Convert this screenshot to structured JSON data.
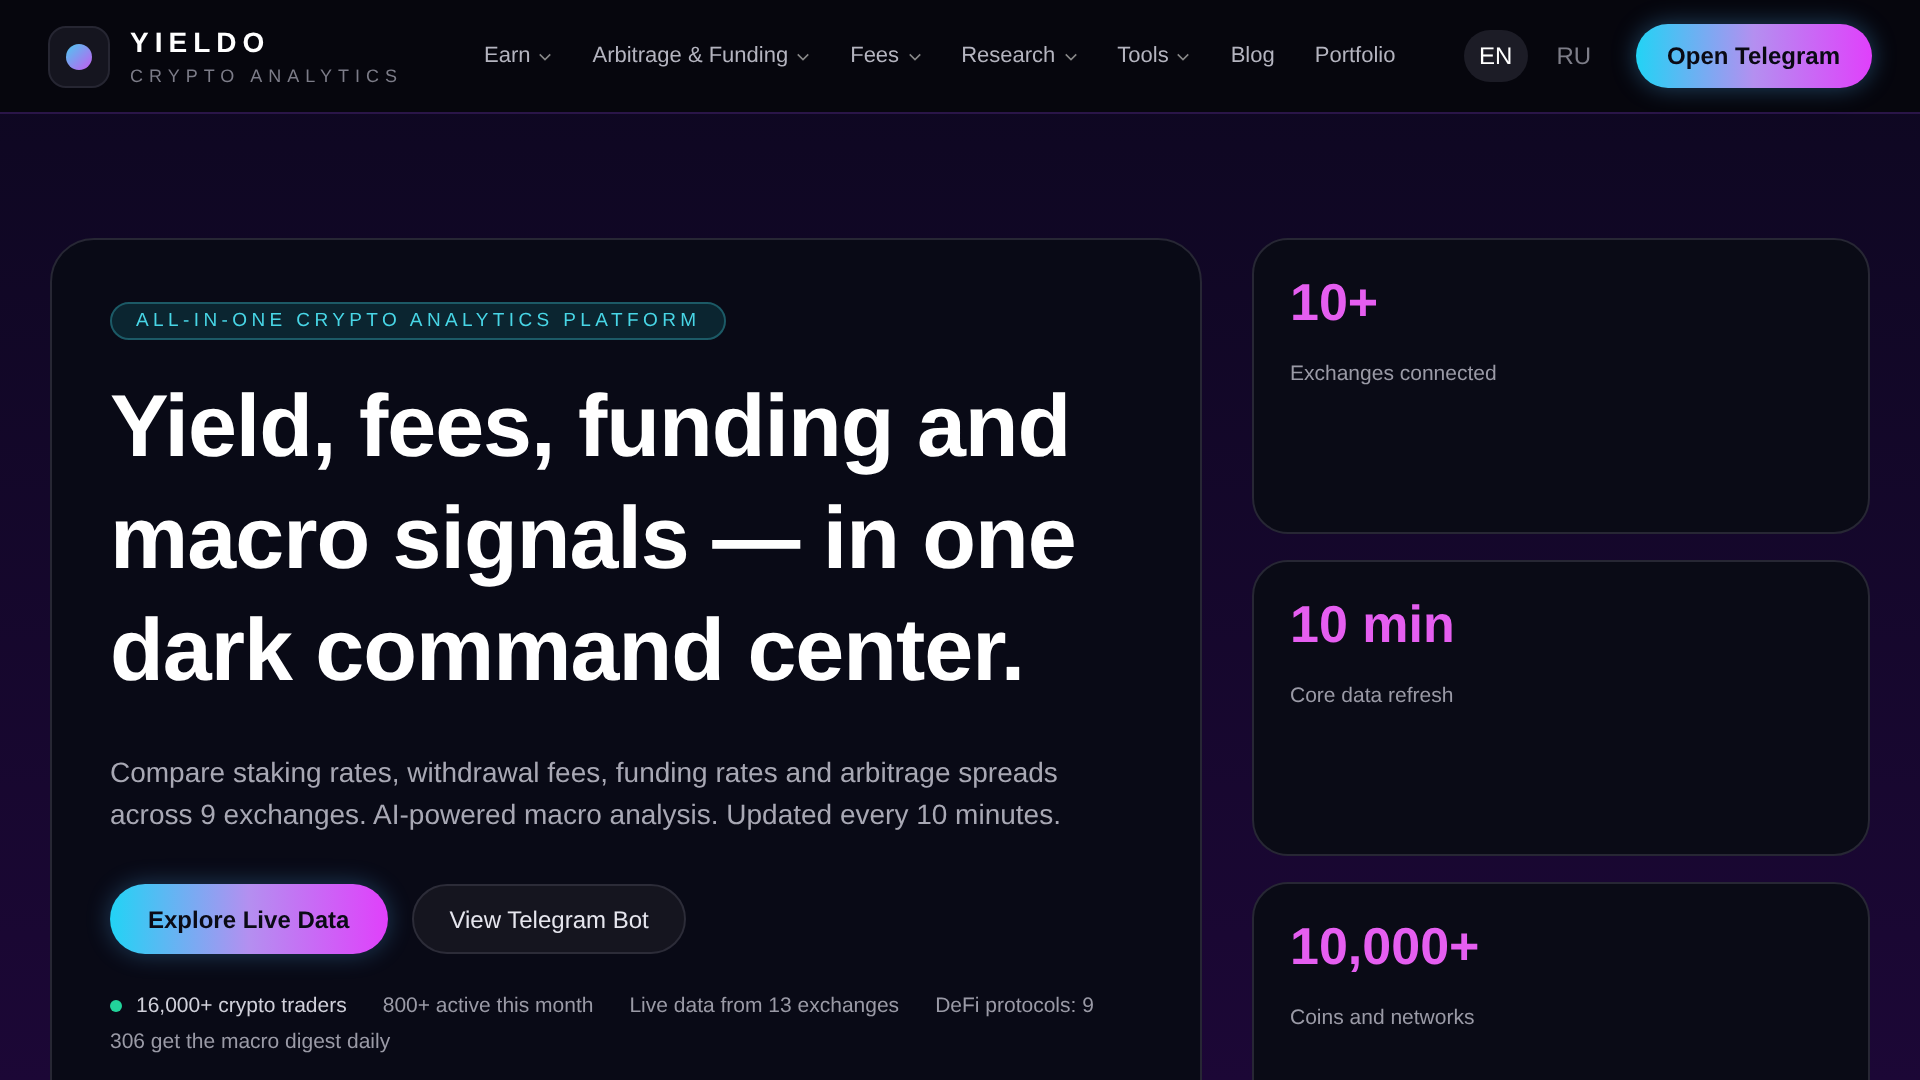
{
  "brand": {
    "name": "YIELDO",
    "tagline": "CRYPTO ANALYTICS"
  },
  "nav": [
    {
      "label": "Earn",
      "has_dropdown": true
    },
    {
      "label": "Arbitrage & Funding",
      "has_dropdown": true
    },
    {
      "label": "Fees",
      "has_dropdown": true
    },
    {
      "label": "Research",
      "has_dropdown": true
    },
    {
      "label": "Tools",
      "has_dropdown": true
    },
    {
      "label": "Blog",
      "has_dropdown": false
    },
    {
      "label": "Portfolio",
      "has_dropdown": false
    }
  ],
  "languages": [
    {
      "label": "EN",
      "selected": true
    },
    {
      "label": "RU",
      "selected": false
    }
  ],
  "cta": "Open Telegram",
  "hero": {
    "eyebrow": "ALL-IN-ONE CRYPTO ANALYTICS PLATFORM",
    "title": "Yield, fees, funding and macro signals — in one dark command center.",
    "description": "Compare staking rates, withdrawal fees, funding rates and arbitrage spreads across 9 exchanges. AI-powered macro analysis. Updated every 10 minutes.",
    "primary_button": "Explore Live Data",
    "secondary_button": "View Telegram Bot",
    "proof": [
      {
        "text": "16,000+ crypto traders",
        "dot": true
      },
      {
        "text": "800+ active this month",
        "dot": false
      },
      {
        "text": "Live data from 13 exchanges",
        "dot": false
      },
      {
        "text": "DeFi protocols: 9",
        "dot": false
      },
      {
        "text": "306 get the macro digest daily",
        "dot": false
      }
    ]
  },
  "stats": [
    {
      "value": "10+",
      "label": "Exchanges connected"
    },
    {
      "value": "10 min",
      "label": "Core data refresh"
    },
    {
      "value": "10,000+",
      "label": "Coins and networks"
    }
  ]
}
